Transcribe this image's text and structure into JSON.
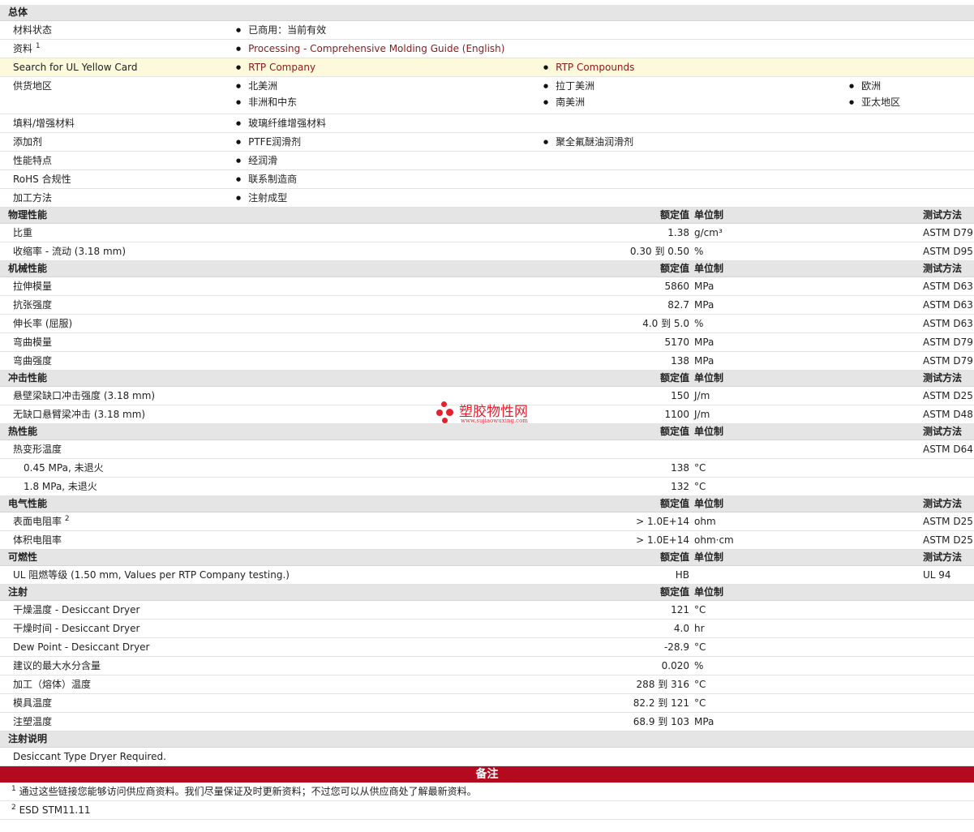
{
  "general": {
    "title": "总体",
    "rows": [
      {
        "label": "材料状态",
        "items": [
          "已商用：当前有效"
        ]
      },
      {
        "label": "资料",
        "sup": "1",
        "items": [
          "Processing - Comprehensive Molding Guide (English)"
        ]
      },
      {
        "label": "Search for UL Yellow Card",
        "items": [
          "RTP Company",
          "RTP Compounds"
        ]
      },
      {
        "label": "供货地区",
        "items": [
          "北美洲",
          "拉丁美洲",
          "欧洲",
          "非洲和中东",
          "南美洲",
          "亚太地区"
        ]
      },
      {
        "label": "填料/增强材料",
        "items": [
          "玻璃纤维增强材料"
        ]
      },
      {
        "label": "添加剂",
        "items": [
          "PTFE润滑剂",
          "聚全氟醚油润滑剂"
        ]
      },
      {
        "label": "性能特点",
        "items": [
          "经润滑"
        ]
      },
      {
        "label": "RoHS 合规性",
        "items": [
          "联系制造商"
        ]
      },
      {
        "label": "加工方法",
        "items": [
          "注射成型"
        ]
      }
    ]
  },
  "headers": {
    "value": "额定值",
    "unit": "单位制",
    "test": "测试方法"
  },
  "physical": {
    "title": "物理性能",
    "rows": [
      {
        "label": "比重",
        "value": "1.38",
        "unit": "g/cm³",
        "test": "ASTM D79"
      },
      {
        "label": "收缩率  - 流动  (3.18 mm)",
        "value": "0.30 到  0.50",
        "unit": "%",
        "test": "ASTM D95"
      }
    ]
  },
  "mechanical": {
    "title": "机械性能",
    "rows": [
      {
        "label": "拉伸模量",
        "value": "5860",
        "unit": "MPa",
        "test": "ASTM D63"
      },
      {
        "label": "抗张强度",
        "value": "82.7",
        "unit": "MPa",
        "test": "ASTM D63"
      },
      {
        "label": "伸长率  (屈服)",
        "value": "4.0 到  5.0",
        "unit": "%",
        "test": "ASTM D63"
      },
      {
        "label": "弯曲模量",
        "value": "5170",
        "unit": "MPa",
        "test": "ASTM D79"
      },
      {
        "label": "弯曲强度",
        "value": "138",
        "unit": "MPa",
        "test": "ASTM D79"
      }
    ]
  },
  "impact": {
    "title": "冲击性能",
    "rows": [
      {
        "label": "悬壁梁缺口冲击强度  (3.18 mm)",
        "value": "150",
        "unit": "J/m",
        "test": "ASTM D25"
      },
      {
        "label": "无缺口悬臂梁冲击  (3.18 mm)",
        "value": "1100",
        "unit": "J/m",
        "test": "ASTM D48"
      }
    ]
  },
  "thermal": {
    "title": "热性能",
    "rows": [
      {
        "label": "热变形温度",
        "value": "",
        "unit": "",
        "test": "ASTM D64"
      },
      {
        "label": "0.45 MPa, 未退火",
        "value": "138",
        "unit": "°C",
        "test": ""
      },
      {
        "label": "1.8 MPa, 未退火",
        "value": "132",
        "unit": "°C",
        "test": ""
      }
    ]
  },
  "electrical": {
    "title": "电气性能",
    "rows": [
      {
        "label": "表面电阻率",
        "sup": "2",
        "value": "> 1.0E+14",
        "unit": "ohm",
        "test": "ASTM D25"
      },
      {
        "label": "体积电阻率",
        "value": "> 1.0E+14",
        "unit": "ohm·cm",
        "test": "ASTM D25"
      }
    ]
  },
  "flammability": {
    "title": "可燃性",
    "rows": [
      {
        "label": "UL 阻燃等级  (1.50 mm, Values per RTP Company testing.)",
        "value": "HB",
        "unit": "",
        "test": "UL 94"
      }
    ]
  },
  "injection": {
    "title": "注射",
    "rows": [
      {
        "label": "干燥温度  - Desiccant Dryer",
        "value": "121",
        "unit": "°C"
      },
      {
        "label": "干燥时间  - Desiccant Dryer",
        "value": "4.0",
        "unit": "hr"
      },
      {
        "label": "Dew Point - Desiccant Dryer",
        "value": "-28.9",
        "unit": "°C"
      },
      {
        "label": "建议的最大水分含量",
        "value": "0.020",
        "unit": "%"
      },
      {
        "label": "加工（熔体）温度",
        "value": "288 到  316",
        "unit": "°C"
      },
      {
        "label": "模具温度",
        "value": "82.2 到  121",
        "unit": "°C"
      },
      {
        "label": "注塑温度",
        "value": "68.9 到  103",
        "unit": "MPa"
      }
    ]
  },
  "injection_notes": {
    "title": "注射说明",
    "text": "Desiccant Type Dryer Required."
  },
  "notes": {
    "title": "备注",
    "items": [
      {
        "num": "1",
        "text": "通过这些链接您能够访问供应商资料。我们尽量保证及时更新资料；不过您可以从供应商处了解最新资料。"
      },
      {
        "num": "2",
        "text": "ESD STM11.11"
      }
    ]
  },
  "watermark": {
    "text": "塑胶物性网",
    "url": "www.sujiaowuxing.com",
    "color": "#e3222e"
  },
  "colors": {
    "section_bg": "#e5e5e5",
    "highlight_bg": "#fdfadc",
    "link": "#8b1a1a",
    "notes_bar": "#b30a1f"
  }
}
